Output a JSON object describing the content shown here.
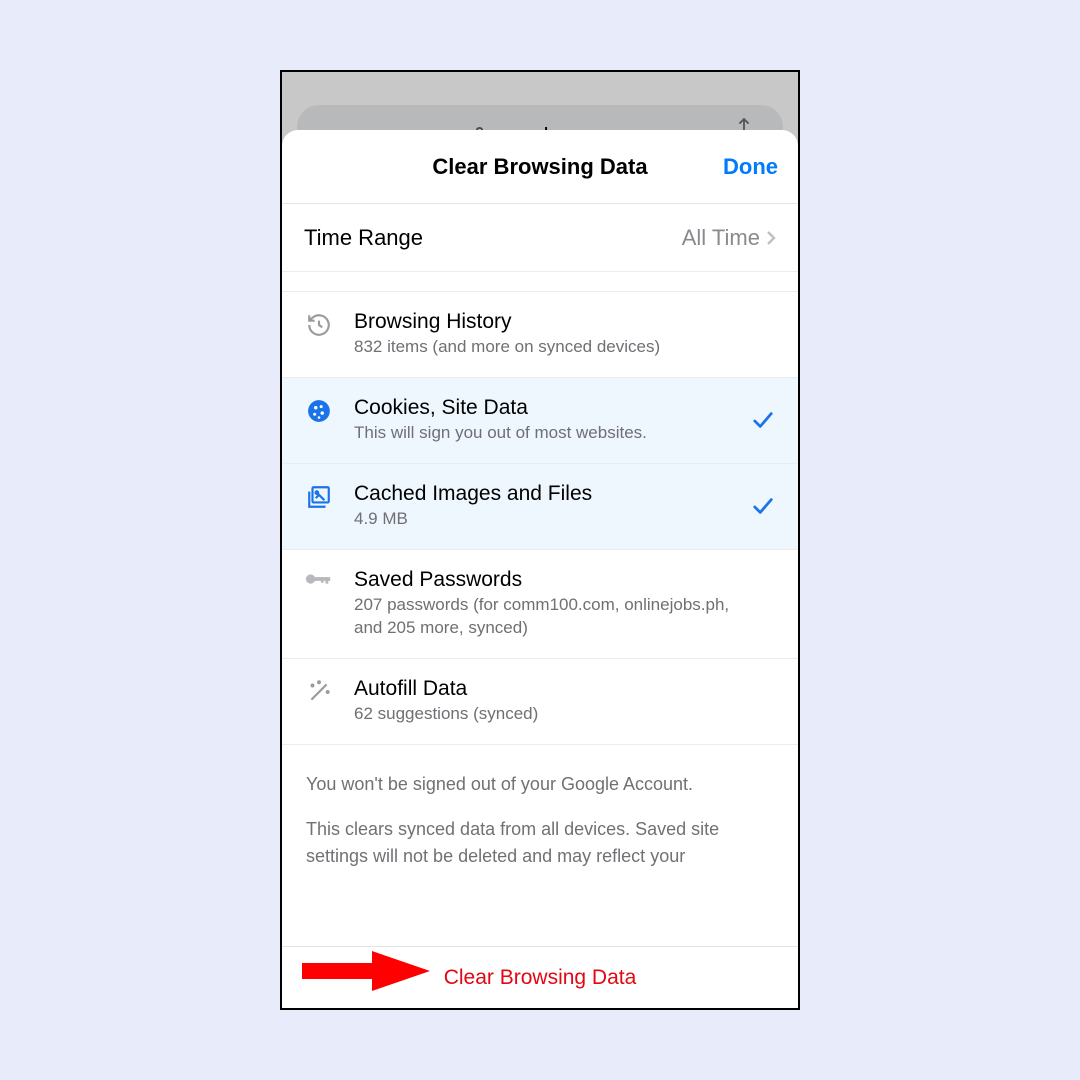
{
  "address_bar": {
    "url_text": "google.com"
  },
  "sheet": {
    "title": "Clear Browsing Data",
    "done_label": "Done",
    "time_range": {
      "label": "Time Range",
      "value": "All Time"
    },
    "options": [
      {
        "title": "Browsing History",
        "subtitle": "832 items (and more on synced devices)"
      },
      {
        "title": "Cookies, Site Data",
        "subtitle": "This will sign you out of most websites."
      },
      {
        "title": "Cached Images and Files",
        "subtitle": "4.9 MB"
      },
      {
        "title": "Saved Passwords",
        "subtitle": "207 passwords (for comm100.com, onlinejobs.ph, and 205 more, synced)"
      },
      {
        "title": "Autofill Data",
        "subtitle": "62 suggestions (synced)"
      }
    ],
    "info1": "You won't be signed out of your Google Account.",
    "info2": "This clears synced data from all devices. Saved site settings will not be deleted and may reflect your",
    "clear_button": "Clear Browsing Data"
  }
}
